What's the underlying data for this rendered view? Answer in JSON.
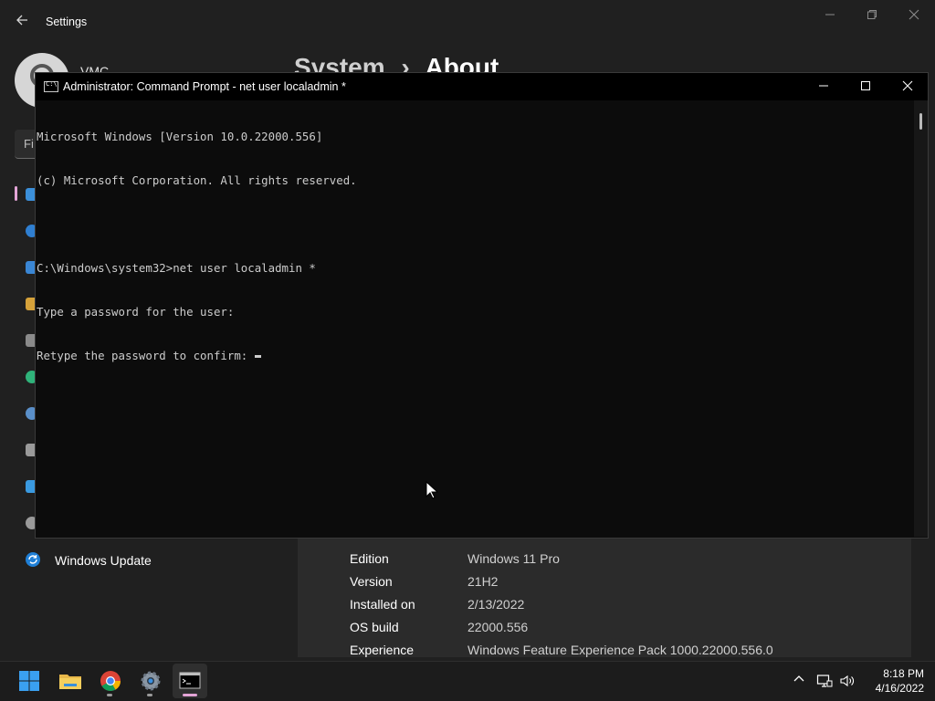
{
  "settings": {
    "title": "Settings",
    "user_name": "VMC",
    "breadcrumb": {
      "parent": "System",
      "separator": "›",
      "current": "About"
    },
    "search_placeholder": "Fi",
    "nav_windows_update": "Windows Update",
    "specs": [
      {
        "key": "Edition",
        "value": "Windows 11 Pro"
      },
      {
        "key": "Version",
        "value": "21H2"
      },
      {
        "key": "Installed on",
        "value": "2/13/2022"
      },
      {
        "key": "OS build",
        "value": "22000.556"
      },
      {
        "key": "Experience",
        "value": "Windows Feature Experience Pack 1000.22000.556.0"
      }
    ]
  },
  "cmd": {
    "title": "Administrator: Command Prompt - net  user localadmin *",
    "icon_text": "C:\\",
    "lines": [
      "Microsoft Windows [Version 10.0.22000.556]",
      "(c) Microsoft Corporation. All rights reserved.",
      "",
      "C:\\Windows\\system32>net user localadmin *",
      "Type a password for the user:",
      "Retype the password to confirm: "
    ]
  },
  "taskbar": {
    "apps": [
      "start-icon",
      "file-explorer-icon",
      "chrome-icon",
      "settings-gear-icon",
      "command-prompt-icon"
    ],
    "time": "8:18 PM",
    "date": "4/16/2022"
  },
  "colors": {
    "accent": "#e3a4d6",
    "console_bg": "#0c0c0c",
    "console_text": "#cccccc",
    "settings_bg": "#202020"
  }
}
